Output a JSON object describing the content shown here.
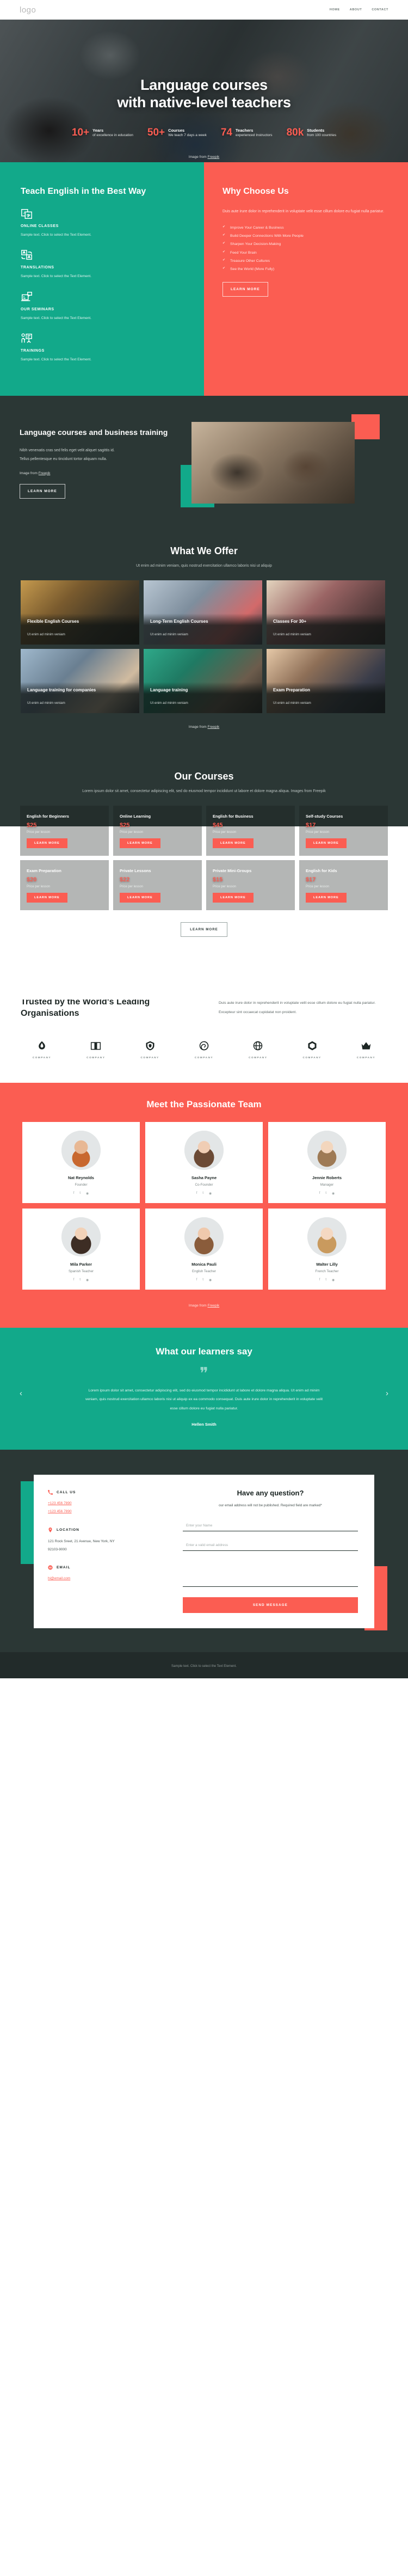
{
  "header": {
    "logo": "logo",
    "nav": [
      {
        "label": "HOME"
      },
      {
        "label": "ABOUT"
      },
      {
        "label": "CONTACT"
      }
    ]
  },
  "hero": {
    "title_line1": "Language courses",
    "title_line2": "with native-level teachers",
    "stats": [
      {
        "number": "10+",
        "label": "Years",
        "sub": "of excellence in education"
      },
      {
        "number": "50+",
        "label": "Courses",
        "sub": "We teach 7 days a week"
      },
      {
        "number": "74",
        "label": "Teachers",
        "sub": "experienced Instructors"
      },
      {
        "number": "80k",
        "label": "Students",
        "sub": "from 100 countries"
      }
    ],
    "credit_prefix": "Image from ",
    "credit_link": "Freepik"
  },
  "teach": {
    "title": "Teach English in the Best Way",
    "features": [
      {
        "icon": "translate-cards-icon",
        "title": "ONLINE CLASSES",
        "desc": "Sample text. Click to select the Text Element."
      },
      {
        "icon": "translate-swap-icon",
        "title": "TRANSLATIONS",
        "desc": "Sample text. Click to select the Text Element."
      },
      {
        "icon": "laptop-presentation-icon",
        "title": "OUR SEMINARS",
        "desc": "Sample text. Click to select the Text Element."
      },
      {
        "icon": "teacher-board-icon",
        "title": "TRAININGS",
        "desc": "Sample text. Click to select the Text Element."
      }
    ]
  },
  "why": {
    "title": "Why Choose Us",
    "lead": "Duis aute irure dolor in reprehenderit in voluptate velit esse cillum dolore eu fugiat nulla pariatur.",
    "items": [
      "Improve Your Career & Business",
      "Build Deeper Connections With More People",
      "Sharpen Your Decision-Making",
      "Feed Your Brain",
      "Treasure Other Cultures",
      "See the World (More Fully)"
    ],
    "cta": "LEARN MORE"
  },
  "business": {
    "title": "Language courses and business training",
    "p1": "Nibh venenatis cras sed felis eget velit aliquet sagittis id.",
    "p2": "Tellus pellentesque eu tincidunt tortor aliquam nulla.",
    "credit_prefix": "Image from ",
    "credit_link": "Freepik",
    "cta": "LEARN MORE"
  },
  "offer": {
    "title": "What We Offer",
    "subtitle": "Ut enim ad minim veniam, quis nostrud exercitation ullamco laboris nisi ut aliquip",
    "cards": [
      {
        "title": "Flexible English Courses",
        "sub": "Ut enim ad minim veniam"
      },
      {
        "title": "Long-Term English Courses",
        "sub": "Ut enim ad minim veniam"
      },
      {
        "title": "Classes For 30+",
        "sub": "Ut enim ad minim veniam"
      },
      {
        "title": "Language training for companies",
        "sub": "Ut enim ad minim veniam"
      },
      {
        "title": "Language training",
        "sub": "Ut enim ad minim veniam"
      },
      {
        "title": "Exam Preparation",
        "sub": "Ut enim ad minim veniam"
      }
    ],
    "credit_prefix": "Image from ",
    "credit_link": "Freepik"
  },
  "courses": {
    "title": "Our Courses",
    "subtitle": "Lorem ipsum dolor sit amet, consectetur adipiscing elit, sed do eiusmod tempor incididunt ut labore et dolore magna aliqua. Images from Freepik",
    "price_caption": "Price per lesson",
    "cta": "LEARN MORE",
    "items": [
      {
        "title": "English for Beginners",
        "price": "$25"
      },
      {
        "title": "Online Learning",
        "price": "$25"
      },
      {
        "title": "English for Business",
        "price": "$45"
      },
      {
        "title": "Self-study Courses",
        "price": "$17"
      },
      {
        "title": "Exam Preparation",
        "price": "$20"
      },
      {
        "title": "Private Lessons",
        "price": "$22"
      },
      {
        "title": "Private Mini-Groups",
        "price": "$15"
      },
      {
        "title": "English for Kids",
        "price": "$17"
      }
    ],
    "more_cta": "LEARN MORE"
  },
  "trusted": {
    "title": "Trusted by the World's Leading Organisations",
    "text": "Duis aute irure dolor in reprehenderit in voluptate velit esse cillum dolore eu fugiat nulla pariatur. Excepteur sint occaecat cupidatat non proident.",
    "logos": [
      {
        "icon": "leaf-drop-logo-icon",
        "name": "COMPANY"
      },
      {
        "icon": "book-open-logo-icon",
        "name": "COMPANY"
      },
      {
        "icon": "shield-logo-icon",
        "name": "COMPANY"
      },
      {
        "icon": "spiral-logo-icon",
        "name": "COMPANY"
      },
      {
        "icon": "globe-logo-icon",
        "name": "COMPANY"
      },
      {
        "icon": "hexagon-logo-icon",
        "name": "COMPANY"
      },
      {
        "icon": "crown-logo-icon",
        "name": "COMPANY"
      }
    ]
  },
  "team": {
    "title": "Meet the Passionate Team",
    "members": [
      {
        "name": "Nat Reynolds",
        "role": "Founder"
      },
      {
        "name": "Sasha Payne",
        "role": "Co-Founder"
      },
      {
        "name": "Jennie Roberts",
        "role": "Manager"
      },
      {
        "name": "Mila Parker",
        "role": "Spanish Teacher"
      },
      {
        "name": "Monica Pauli",
        "role": "English Teacher"
      },
      {
        "name": "Walter Lilly",
        "role": "French Teacher"
      }
    ],
    "social_icons": [
      "facebook-icon",
      "twitter-icon",
      "instagram-icon"
    ],
    "credit_prefix": "Image from ",
    "credit_link": "Freepik"
  },
  "testimonial": {
    "title": "What our learners say",
    "quote_glyph": "❞",
    "text": "Lorem ipsum dolor sit amet, consectetur adipiscing elit, sed do eiusmod tempor incididunt ut labore et dolore magna aliqua. Ut enim ad minim veniam, quis nostrud exercitation ullamco laboris nisi ut aliquip ex ea commodo consequat. Duis aute irure dolor in reprehenderit in voluptate velit esse cillum dolore eu fugiat nulla pariatur.",
    "author": "Hellen Smith",
    "prev": "‹",
    "next": "›"
  },
  "contact": {
    "call_label": "CALL US",
    "phones": [
      "+123 456 7890",
      "+123 456 7890"
    ],
    "location_label": "LOCATION",
    "address_line1": "121 Rock Sreet, 21 Avenue, New York, NY",
    "address_line2": "92103-9000",
    "email_label": "EMAIL",
    "email": "hi@email.com",
    "form": {
      "title": "Have any question?",
      "note": "our email address will not be published. Required field are marked*",
      "name_placeholder": "Enter your Name",
      "email_placeholder": "Enter a valid email address",
      "message_placeholder": "",
      "submit": "SEND MESSAGE"
    }
  },
  "footer": {
    "credit": "Sample text. Click to select the Text Element."
  },
  "colors": {
    "teal": "#12a98a",
    "red": "#fb5d52",
    "dark": "#2b3735"
  }
}
